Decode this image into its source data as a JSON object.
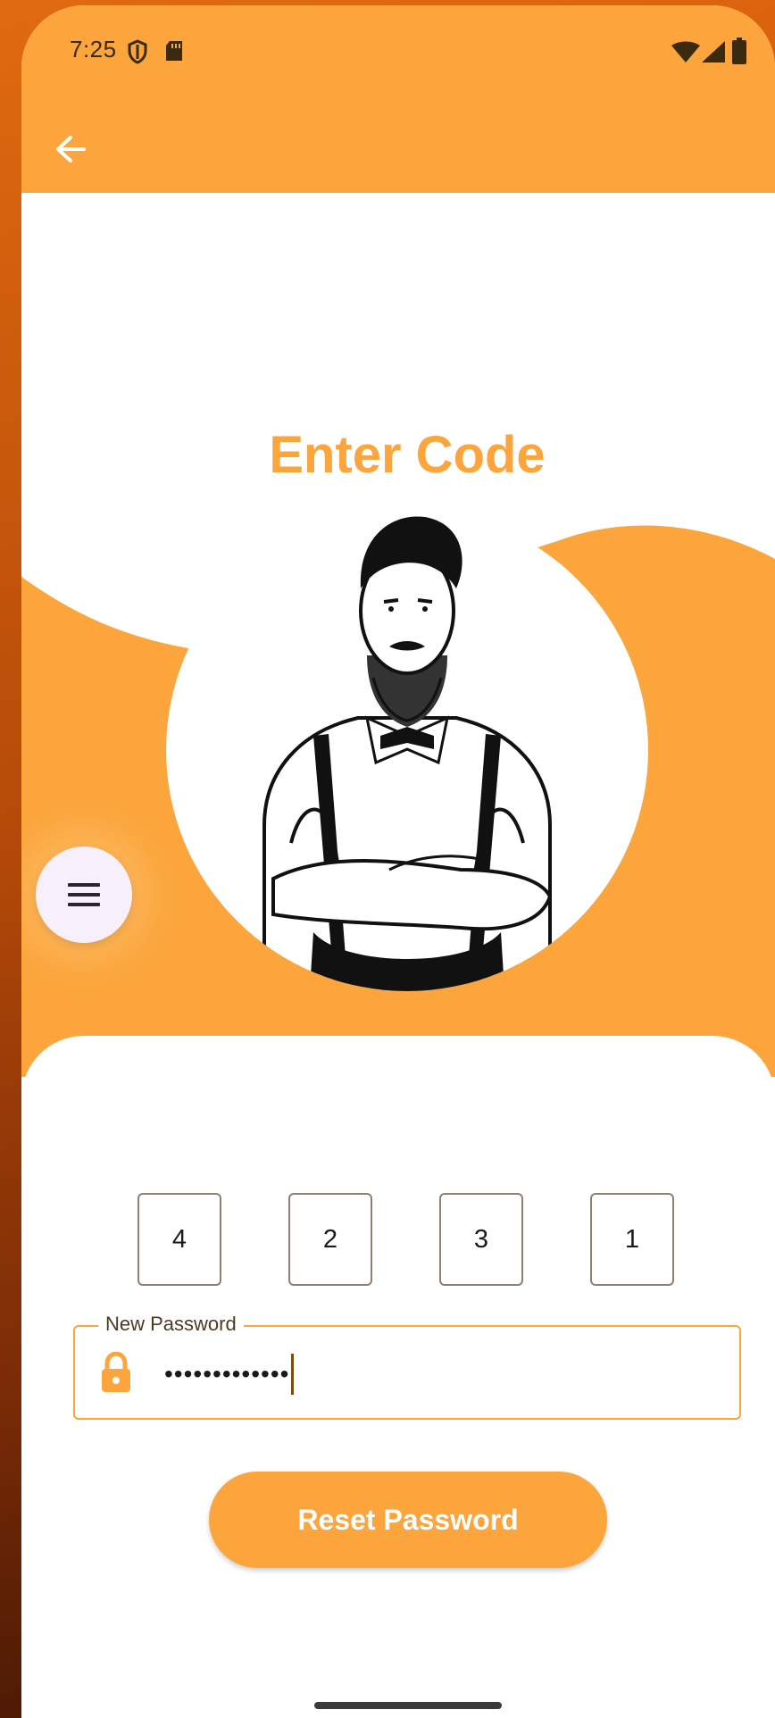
{
  "status_bar": {
    "time": "7:25",
    "left_icons": [
      "shield-icon",
      "sd-card-icon"
    ],
    "right_icons": [
      "wifi-icon",
      "signal-icon",
      "battery-icon"
    ]
  },
  "app_bar": {
    "back_icon": "arrow-left-icon"
  },
  "page": {
    "title": "Enter Code"
  },
  "fab": {
    "icon": "menu-icon"
  },
  "code": {
    "digits": [
      "4",
      "2",
      "3",
      "1"
    ]
  },
  "new_password": {
    "label": "New Password",
    "value": "•••••••••••••",
    "icon": "lock-icon"
  },
  "actions": {
    "reset_label": "Reset Password"
  },
  "colors": {
    "accent": "#fba53c",
    "background": "#ffffff",
    "text": "#1c1a17"
  }
}
